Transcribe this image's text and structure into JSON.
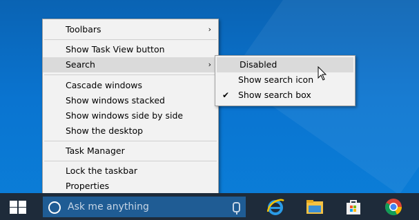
{
  "context_menu": {
    "items": [
      {
        "label": "Toolbars",
        "has_submenu": true
      },
      {
        "label": "Show Task View button"
      },
      {
        "label": "Search",
        "has_submenu": true,
        "highlighted": true
      },
      {
        "label": "Cascade windows"
      },
      {
        "label": "Show windows stacked"
      },
      {
        "label": "Show windows side by side"
      },
      {
        "label": "Show the desktop"
      },
      {
        "label": "Task Manager"
      },
      {
        "label": "Lock the taskbar"
      },
      {
        "label": "Properties"
      }
    ],
    "submenu_arrow": "›"
  },
  "search_submenu": {
    "items": [
      {
        "label": "Disabled",
        "highlighted": true
      },
      {
        "label": "Show search icon"
      },
      {
        "label": "Show search box",
        "checked": true
      }
    ],
    "check_mark": "✔"
  },
  "taskbar": {
    "search_placeholder": "Ask me anything",
    "pinned_icons": [
      "internet-explorer-icon",
      "file-explorer-icon",
      "store-icon",
      "chrome-icon"
    ]
  },
  "colors": {
    "desktop": "#0a74d0",
    "taskbar": "#1e2b3a",
    "search_box": "#1f5c94",
    "menu_bg": "#f2f2f2",
    "menu_highlight": "#dadada"
  }
}
